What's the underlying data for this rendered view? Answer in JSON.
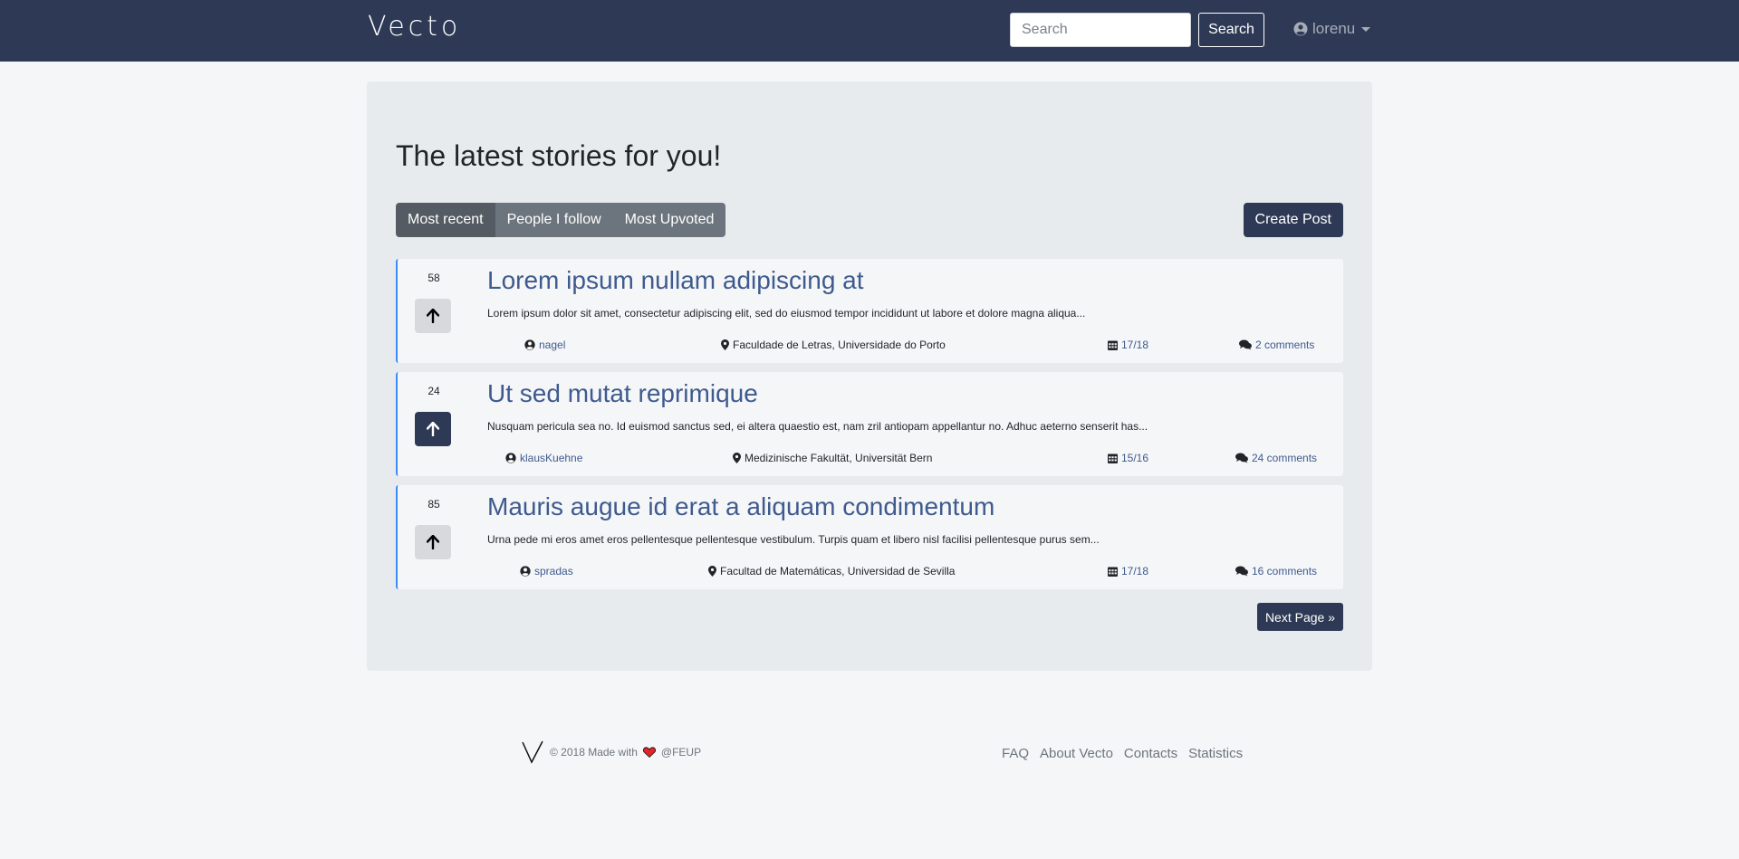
{
  "navbar": {
    "brand": "Vecto",
    "search_placeholder": "Search",
    "search_button": "Search",
    "username": "lorenu"
  },
  "main": {
    "title": "The latest stories for you!",
    "tabs": [
      {
        "label": "Most recent",
        "active": true
      },
      {
        "label": "People I follow",
        "active": false
      },
      {
        "label": "Most Upvoted",
        "active": false
      }
    ],
    "create_button": "Create Post",
    "next_button": "Next Page »"
  },
  "posts": [
    {
      "votes": "58",
      "voted": false,
      "title": "Lorem ipsum nullam adipiscing at",
      "excerpt": "Lorem ipsum dolor sit amet, consectetur adipiscing elit, sed do eiusmod tempor incididunt ut labore et dolore magna aliqua...",
      "author": "nagel",
      "location": "Faculdade de Letras, Universidade do Porto",
      "date": "17/18",
      "comments": "2 comments"
    },
    {
      "votes": "24",
      "voted": true,
      "title": "Ut sed mutat reprimique",
      "excerpt": "Nusquam pericula sea no. Id euismod sanctus sed, ei altera quaestio est, nam zril antiopam appellantur no. Adhuc aeterno senserit has...",
      "author": "klausKuehne",
      "location": "Medizinische Fakultät, Universität Bern",
      "date": "15/16",
      "comments": "24 comments"
    },
    {
      "votes": "85",
      "voted": false,
      "title": "Mauris augue id erat a aliquam condimentum",
      "excerpt": "Urna pede mi eros amet eros pellentesque pellentesque vestibulum. Turpis quam et libero nisl facilisi pellentesque purus sem...",
      "author": "spradas",
      "location": "Facultad de Matemáticas, Universidad de Sevilla",
      "date": "17/18",
      "comments": "16 comments"
    }
  ],
  "footer": {
    "copyright": "© 2018 Made with",
    "org": "@FEUP",
    "links": [
      "FAQ",
      "About Vecto",
      "Contacts",
      "Statistics"
    ]
  },
  "colors": {
    "navbar": "#2e3a55",
    "accent_link": "#3e5a8e",
    "post_border": "#3d8bfd",
    "heart": "#e0242e"
  }
}
